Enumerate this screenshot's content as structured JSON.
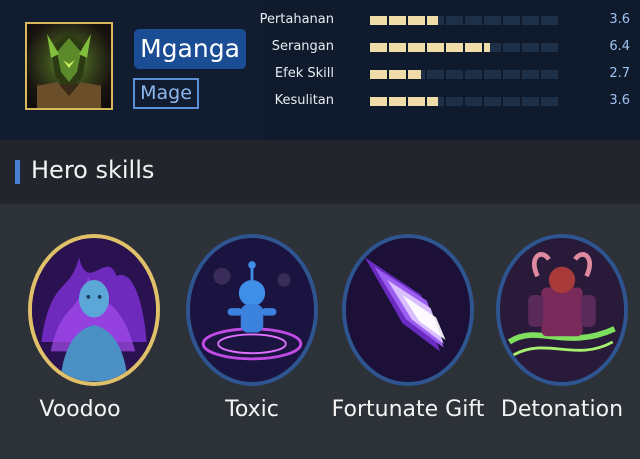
{
  "hero": {
    "name": "Mganga",
    "role": "Mage"
  },
  "stats": [
    {
      "label": "Pertahanan",
      "value": "3.6",
      "level": 3.6
    },
    {
      "label": "Serangan",
      "value": "6.4",
      "level": 6.4
    },
    {
      "label": "Efek Skill",
      "value": "2.7",
      "level": 2.7
    },
    {
      "label": "Kesulitan",
      "value": "3.6",
      "level": 3.6
    }
  ],
  "stat_max": 10,
  "section": {
    "title": "Hero skills"
  },
  "skills": [
    {
      "label": "Voodoo",
      "selected": true,
      "icon": "voodoo-skill-icon"
    },
    {
      "label": "Toxic",
      "selected": false,
      "icon": "toxic-skill-icon"
    },
    {
      "label": "Fortunate Gift",
      "selected": false,
      "icon": "fortunate-gift-skill-icon"
    },
    {
      "label": "Detonation",
      "selected": false,
      "icon": "detonation-skill-icon"
    }
  ],
  "colors": {
    "accent": "#4a7fd4",
    "name_badge": "#1a4d94",
    "selected_ring": "#e1c06a",
    "stat_fill": "#f0dca8",
    "stat_value": "#9fc3f0"
  }
}
